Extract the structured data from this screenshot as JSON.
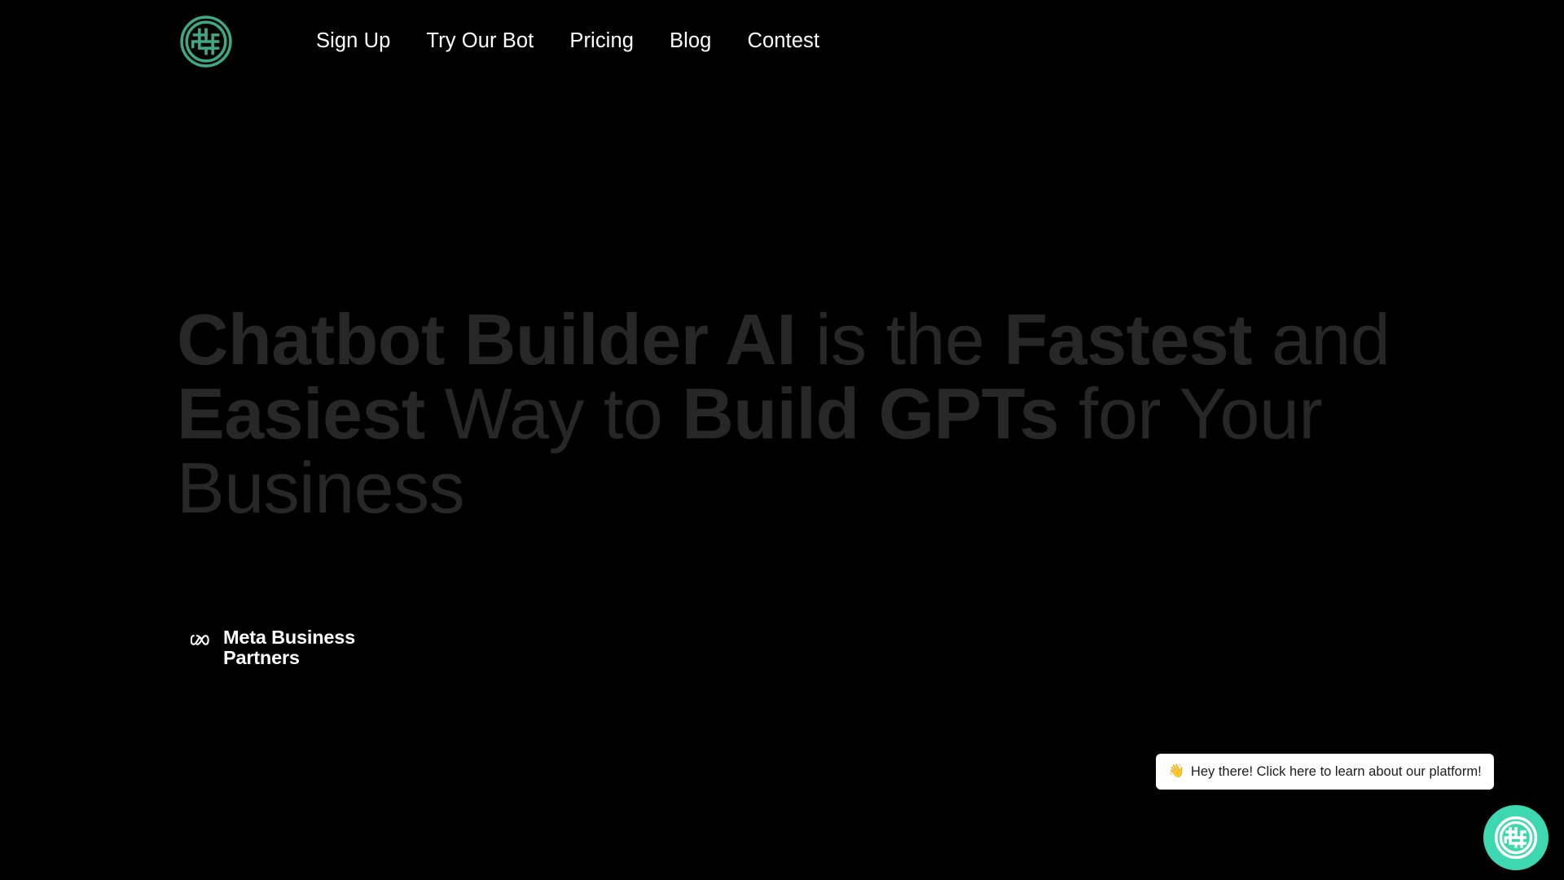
{
  "page": {
    "background_color": "#000000",
    "accent_color": "#3ed8b0",
    "headline_color": "#272727"
  },
  "header": {
    "logo": {
      "icon": "knot-circle-logo",
      "color": "#3ea882",
      "alt": "Chatbot Builder AI"
    },
    "nav": [
      {
        "label": "Sign Up",
        "name": "nav-sign-up"
      },
      {
        "label": "Try Our Bot",
        "name": "nav-try-our-bot"
      },
      {
        "label": "Pricing",
        "name": "nav-pricing"
      },
      {
        "label": "Blog",
        "name": "nav-blog"
      },
      {
        "label": "Contest",
        "name": "nav-contest"
      }
    ]
  },
  "hero": {
    "headline_segments": [
      {
        "text": "Chatbot Builder AI",
        "weight": "bold"
      },
      {
        "text": " is the ",
        "weight": "light"
      },
      {
        "text": "Fastest",
        "weight": "bold"
      },
      {
        "text": " and ",
        "weight": "light"
      },
      {
        "text": "Easiest",
        "weight": "bold"
      },
      {
        "text": " Way to ",
        "weight": "light"
      },
      {
        "text": "Build GPTs",
        "weight": "bold"
      },
      {
        "text": " for Your Business",
        "weight": "light"
      }
    ],
    "headline_plain": "Chatbot Builder AI is the Fastest and Easiest Way to Build GPTs for Your Business",
    "headline": {
      "part1_bold": "Chatbot Builder AI",
      "part2_light": " is the ",
      "part3_bold": "Fastest",
      "part4_light": " and ",
      "part5_bold": "Easiest",
      "part6_light": " Way to ",
      "part7_bold": "Build GPTs",
      "part8_light": " for Your Business"
    },
    "badge": {
      "icon": "meta-infinity-logo",
      "text": "Meta Business Partners"
    }
  },
  "chat_widget": {
    "tooltip": {
      "emoji": "👋",
      "text": "Hey there! Click here to learn about our platform!"
    },
    "launcher": {
      "icon": "knot-circle-logo",
      "background_color": "#3ed8b0",
      "glyph_color": "#ffffff"
    }
  }
}
